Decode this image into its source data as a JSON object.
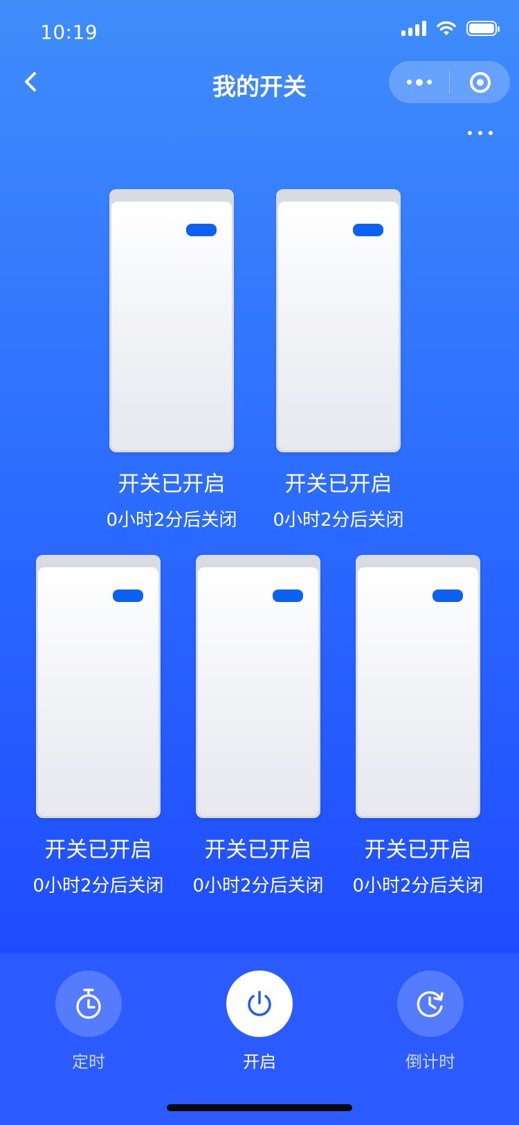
{
  "status_bar": {
    "time": "10:19"
  },
  "nav": {
    "title": "我的开关",
    "back_icon": "chevron-left-icon",
    "capsule_more_icon": "more-dots-icon",
    "capsule_close_icon": "target-icon"
  },
  "switches": [
    {
      "status": "开关已开启",
      "timer": "0小时2分后关闭"
    },
    {
      "status": "开关已开启",
      "timer": "0小时2分后关闭"
    },
    {
      "status": "开关已开启",
      "timer": "0小时2分后关闭"
    },
    {
      "status": "开关已开启",
      "timer": "0小时2分后关闭"
    },
    {
      "status": "开关已开启",
      "timer": "0小时2分后关闭"
    }
  ],
  "actions": [
    {
      "label": "定时",
      "icon": "stopwatch-icon",
      "active": false
    },
    {
      "label": "开启",
      "icon": "power-icon",
      "active": true
    },
    {
      "label": "倒计时",
      "icon": "countdown-clock-icon",
      "active": false
    }
  ],
  "colors": {
    "background_top": "#3f8dfb",
    "background_bottom": "#1d49ff",
    "bottom_bar": "#2b5bff",
    "indicator": "#0b61f3",
    "power_icon": "#1f5cff"
  }
}
